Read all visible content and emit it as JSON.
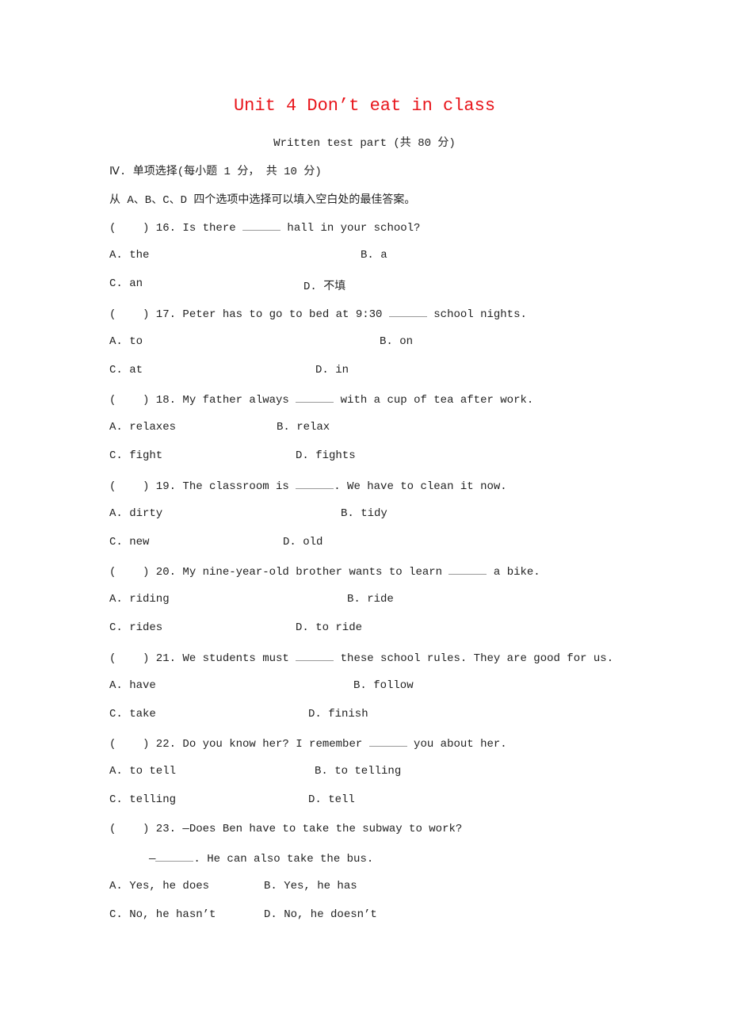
{
  "title": "Unit 4 Don’t eat in class",
  "subtitle": "Written test part (共 80 分)",
  "section": {
    "heading": "Ⅳ. 单项选择(每小题 1 分， 共 10 分)",
    "instruction": "从 A、B、C、D 四个选项中选择可以填入空白处的最佳答案。"
  },
  "questions": [
    {
      "prefix": "(    ) 16. Is there ",
      "suffix": " hall in your school?",
      "options": [
        "A. the",
        "B. a",
        "C. an",
        "D. 不填"
      ]
    },
    {
      "prefix": "(    ) 17. Peter has to go to bed at 9:30 ",
      "suffix": " school nights.",
      "options": [
        "A. to",
        "B. on",
        "C. at",
        "D. in"
      ]
    },
    {
      "prefix": "(    ) 18. My father always ",
      "suffix": " with a cup of tea after work.",
      "options": [
        "A. relaxes",
        "B. relax",
        "C. fight",
        "D. fights"
      ]
    },
    {
      "prefix": "(    ) 19. The classroom is ",
      "suffix": ". We have to clean it now.",
      "options": [
        "A. dirty",
        "B. tidy",
        "C. new",
        "D. old"
      ]
    },
    {
      "prefix": "(    ) 20. My nine-year-old brother wants to learn ",
      "suffix": " a bike.",
      "options": [
        "A. riding",
        "B. ride",
        "C. rides",
        "D. to ride"
      ]
    },
    {
      "prefix": "(    ) 21. We students must ",
      "suffix": " these school rules. They are good for us.",
      "options": [
        "A. have",
        "B. follow",
        "C. take",
        "D. finish"
      ]
    },
    {
      "prefix": "(    ) 22. Do you know her? I remember ",
      "suffix": " you about her.",
      "options": [
        "A. to tell",
        "B. to telling",
        "C. telling",
        "D. tell"
      ]
    },
    {
      "prefix": "(    ) 23. —Does Ben have to take the subway to work?",
      "suffix": "",
      "answer_prefix": "—",
      "answer_suffix": ". He can also take the bus.",
      "options": [
        "A. Yes, he does",
        "B. Yes, he has",
        "C. No, he hasn’t",
        "D. No, he doesn’t"
      ]
    }
  ]
}
